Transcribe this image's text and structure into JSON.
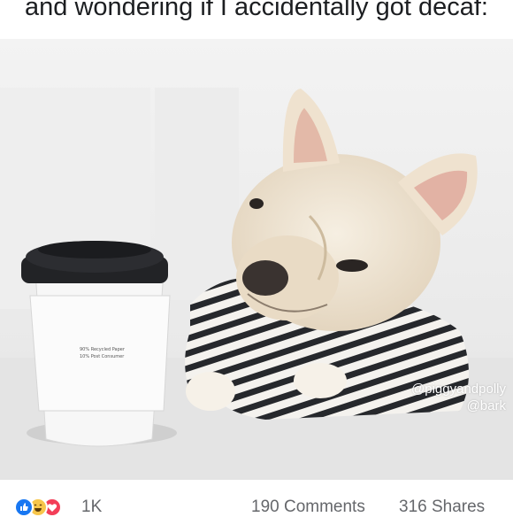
{
  "post": {
    "caption": "and wondering if I accidentally got decaf:",
    "watermark": {
      "line1": "@piggyandpolly",
      "line2": "@bark"
    },
    "cup": {
      "sleeve_text_1": "90% Recycled Paper",
      "sleeve_text_2": "10% Post Consumer"
    }
  },
  "footer": {
    "reactions": [
      "like-icon",
      "haha-icon",
      "love-icon"
    ],
    "reaction_count": "1K",
    "comments": "190 Comments",
    "shares": "316 Shares"
  },
  "colors": {
    "like": "#1877f2",
    "haha": "#f7c64b",
    "love": "#f33e58",
    "meta_text": "#65676b"
  }
}
